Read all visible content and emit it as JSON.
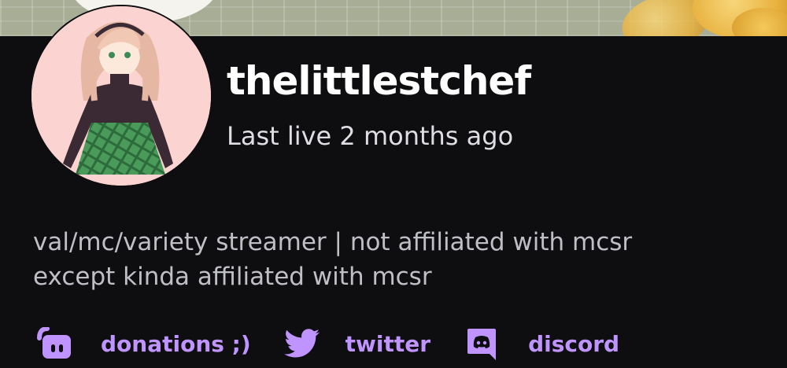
{
  "profile": {
    "username": "thelittlestchef",
    "last_live": "Last live 2 months ago",
    "bio_lines": [
      "val/mc/variety streamer | not affiliated with mcsr",
      "except kinda affiliated with mcsr"
    ]
  },
  "links": [
    {
      "icon": "streamlabs-icon",
      "label": "donations ;)"
    },
    {
      "icon": "twitter-icon",
      "label": "twitter"
    },
    {
      "icon": "discord-icon",
      "label": "discord"
    }
  ],
  "colors": {
    "background": "#0e0e10",
    "accent": "#bf94ff",
    "username": "#ffffff",
    "secondary_text": "#dedee3",
    "bio_text": "#bfbfc6",
    "avatar_bg": "#fbd4d2"
  }
}
